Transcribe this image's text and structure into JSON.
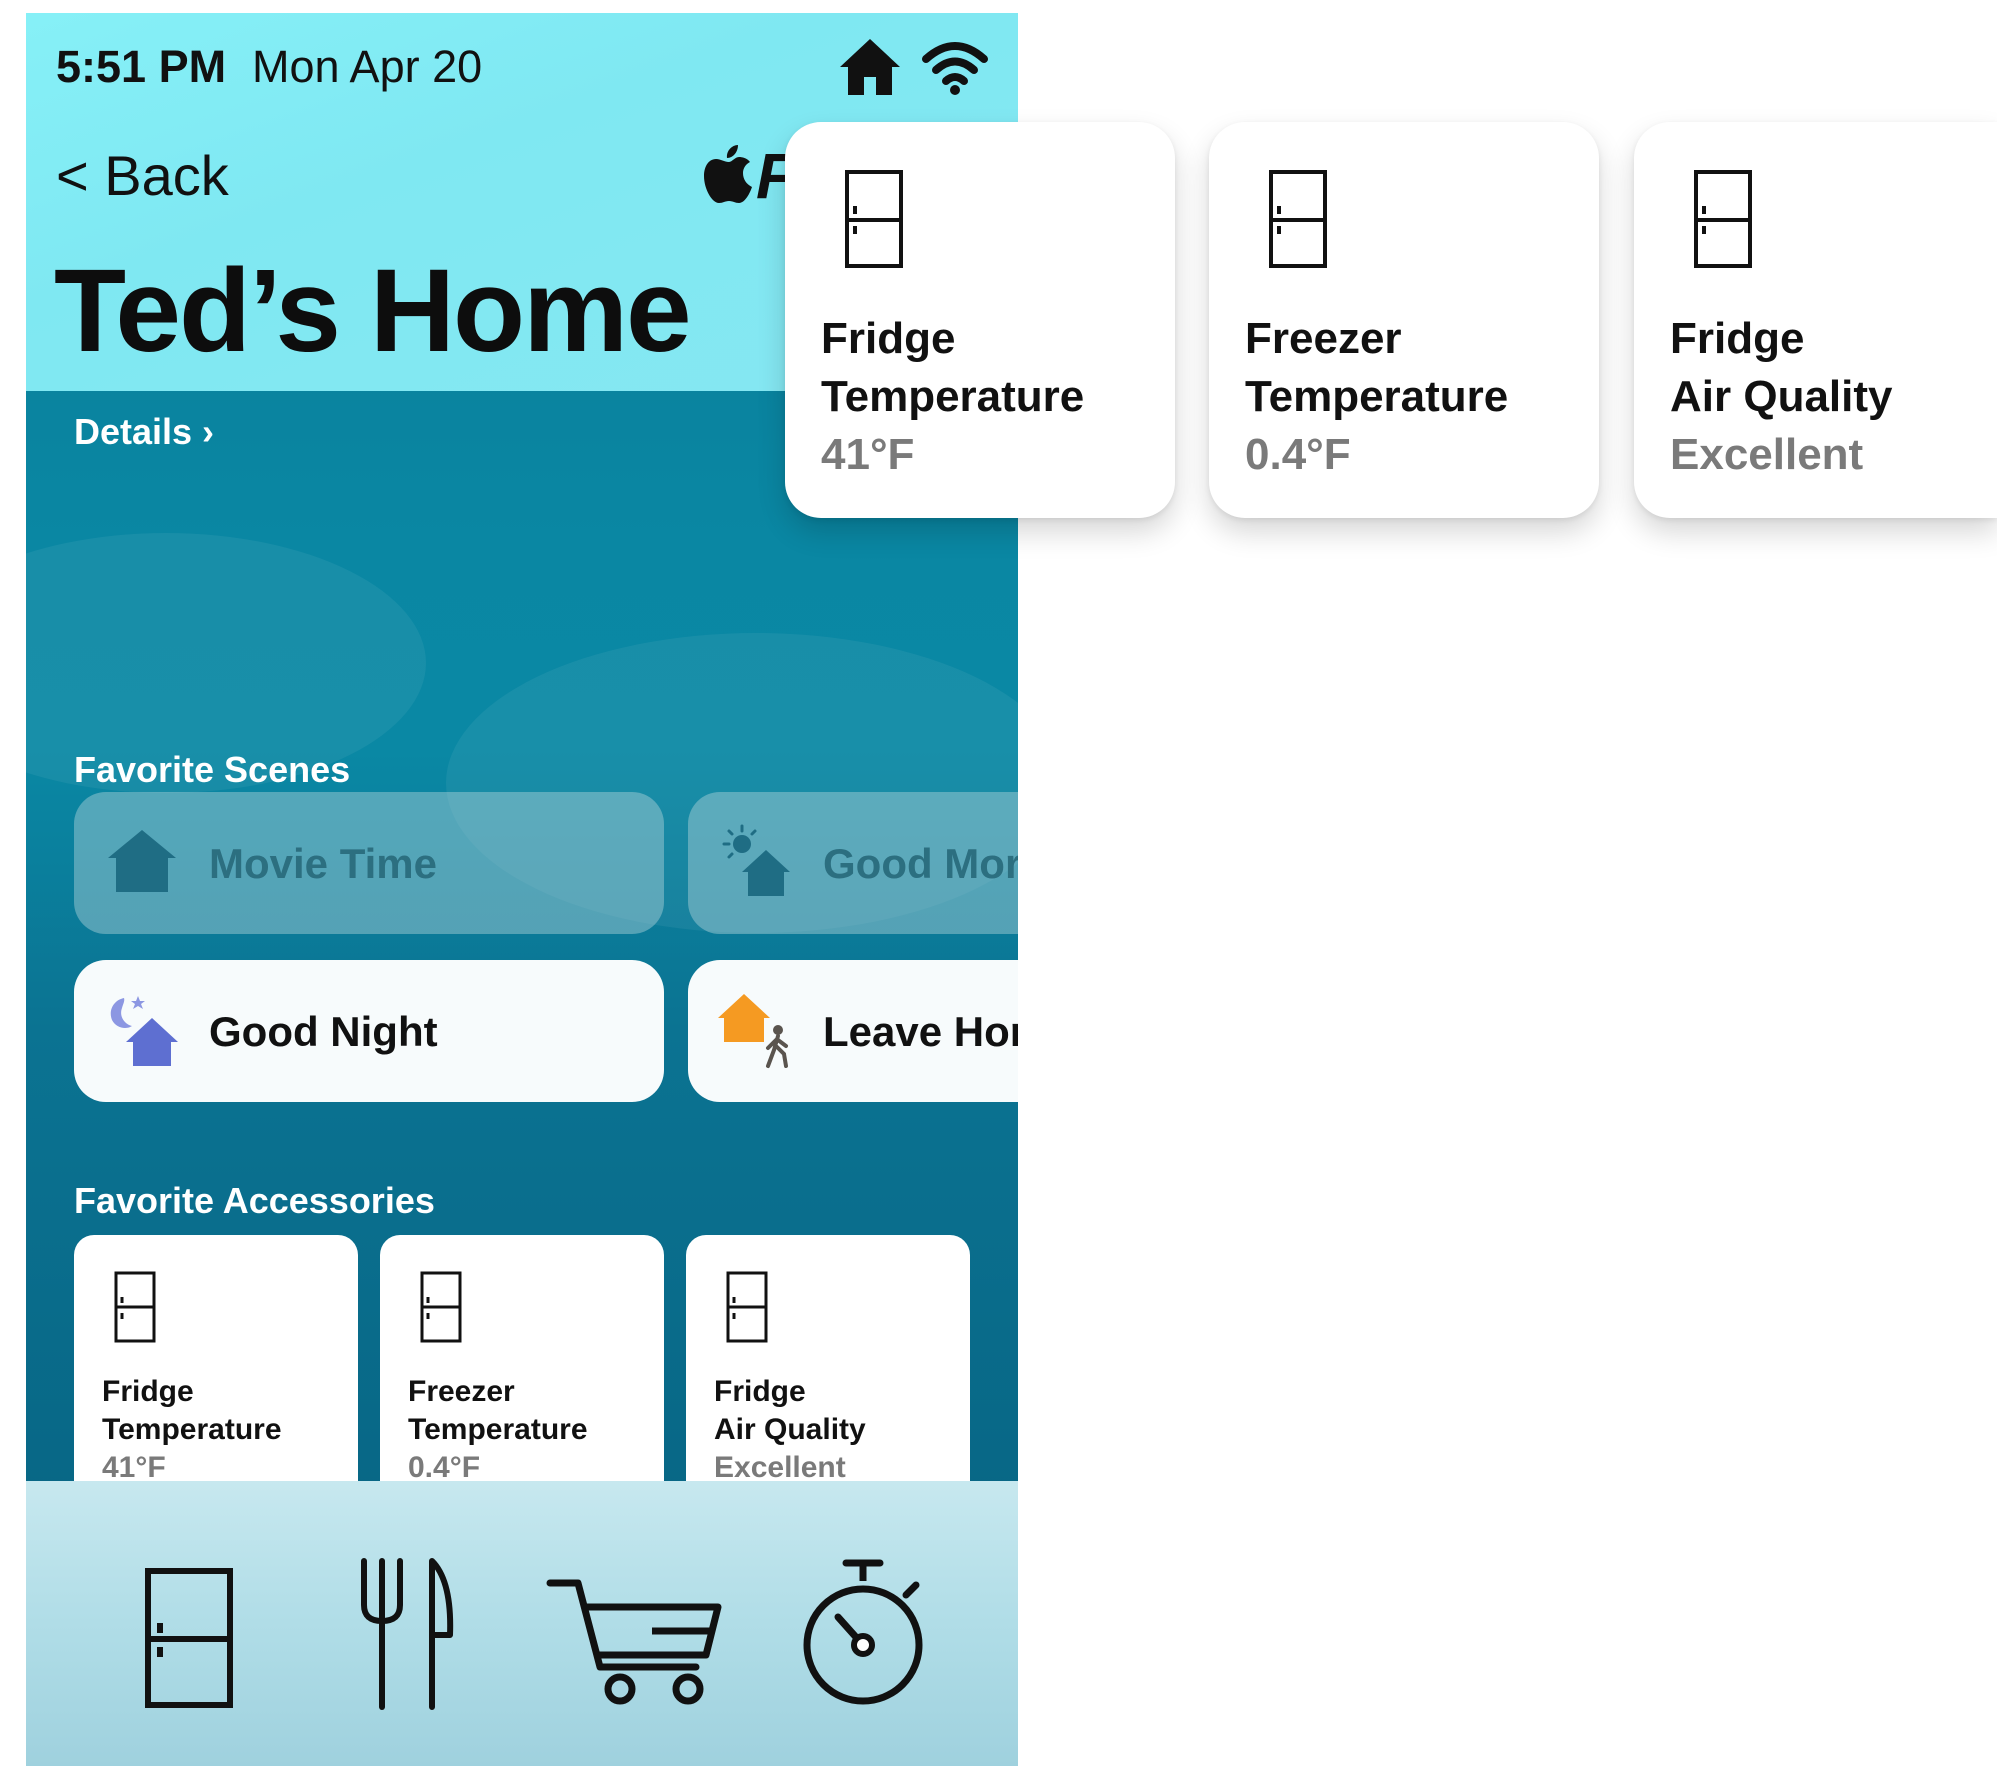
{
  "status_bar": {
    "time": "5:51 PM",
    "date": "Mon Apr 20"
  },
  "header": {
    "back_label": "< Back",
    "brand_fragment": "F",
    "title": "Ted’s Home",
    "details_label": "Details ›"
  },
  "scenes": {
    "section_label": "Favorite Scenes",
    "items": [
      {
        "label": "Movie Time"
      },
      {
        "label": "Good Morning"
      },
      {
        "label": "Good Night"
      },
      {
        "label": "Leave Home"
      }
    ]
  },
  "accessories": {
    "section_label": "Favorite Accessories",
    "items": [
      {
        "line1": "Fridge",
        "line2": "Temperature",
        "value": "41°F"
      },
      {
        "line1": "Freezer",
        "line2": "Temperature",
        "value": "0.4°F"
      },
      {
        "line1": "Fridge",
        "line2": "Air Quality",
        "value": "Excellent"
      }
    ]
  },
  "tab_bar": {
    "icons": [
      "fridge-icon",
      "utensils-icon",
      "cart-icon",
      "timer-icon"
    ]
  },
  "colors": {
    "night_scene": "#5e6fd1",
    "leave_scene": "#f59a22",
    "dim_scene_icon": "#1f6d84"
  }
}
